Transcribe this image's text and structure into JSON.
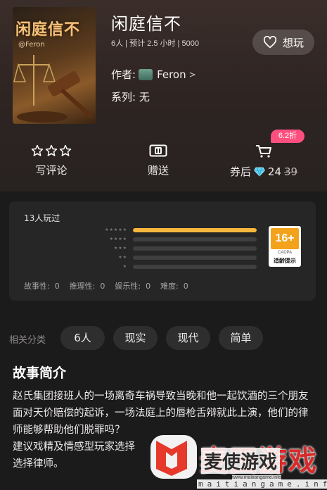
{
  "header": {
    "cover": {
      "title": "闲庭信不",
      "author_mark": "@Feron"
    },
    "title": "闲庭信不",
    "meta": "6人 | 预计 2.5 小时 | 5000",
    "want_button": {
      "label": "想玩",
      "icon": "heart-icon"
    },
    "author": {
      "label": "作者:",
      "name": "Feron",
      "chevron": ">"
    },
    "series": {
      "label": "系列:",
      "value": "无"
    }
  },
  "actions": {
    "review": {
      "label": "写评论",
      "icon": "stars-outline-icon"
    },
    "gift": {
      "label": "赠送",
      "icon": "gift-card-icon"
    },
    "buy": {
      "label": "券后",
      "price": "24",
      "original_price": "39",
      "discount": "6.2折",
      "icon": "cart-icon",
      "currency_icon": "diamond-icon"
    }
  },
  "rating": {
    "played_count": "13人玩过",
    "distribution": [
      {
        "stars": "★★★★★",
        "fraction": 1.0
      },
      {
        "stars": "★★★★",
        "fraction": 0
      },
      {
        "stars": "★★★",
        "fraction": 0
      },
      {
        "stars": "★★",
        "fraction": 0
      },
      {
        "stars": "★",
        "fraction": 0
      }
    ],
    "age_rating": {
      "age": "16+",
      "org": "CADPA",
      "tip": "适龄提示"
    },
    "attributes": "故事性:  0    推理性:  0    娱乐性:  0    难度:  0"
  },
  "categories": {
    "label": "相关分类",
    "tags": [
      "6人",
      "现实",
      "现代",
      "简单"
    ]
  },
  "synopsis": {
    "title": "故事简介",
    "body": "赵氏集团接班人的一场离奇车祸导致当晚和他一起饮酒的三个朋友面对天价赔偿的起诉，一场法庭上的唇枪舌辩就此上演，他们的律师能够帮助他们脱罪吗？\n建议戏精及情感型玩家选择\n选择律师。"
  },
  "watermark": {
    "big_text": "麦田游戏",
    "mid_text": "麦使游戏",
    "small_text": "maitiangame.info",
    "url": "www.maitiangame.info"
  },
  "colors": {
    "accent_yellow": "#f6b73c",
    "discount_pink": "#ff4f7f",
    "age_orange": "#f2a21b"
  }
}
